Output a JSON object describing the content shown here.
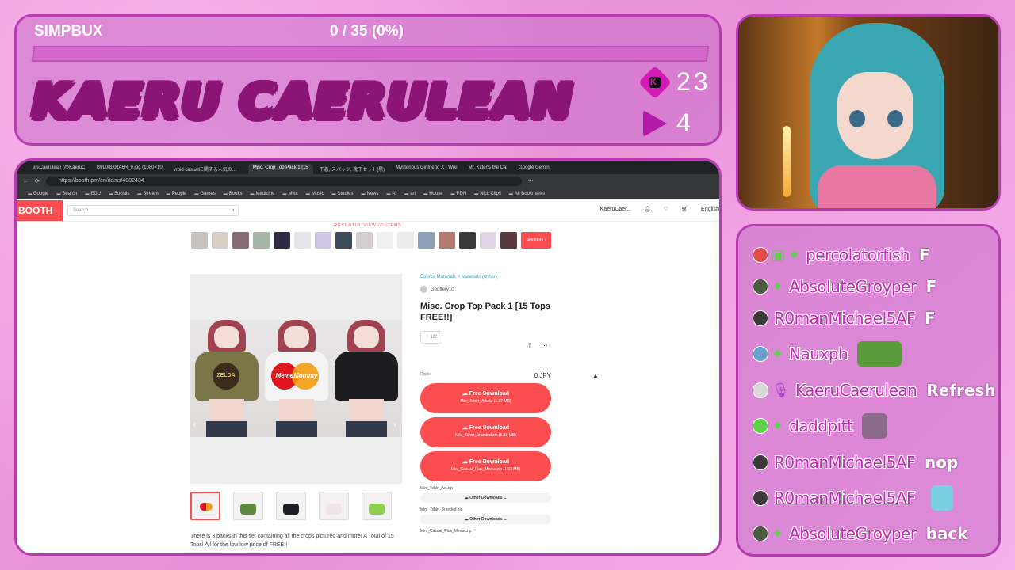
{
  "goal": {
    "label": "SIMPBUX",
    "progress_text": "0 / 35 (0%)",
    "progress": 0
  },
  "streamer": {
    "name": "KAERU CAERULEAN"
  },
  "stats": {
    "kick_count": "23",
    "play_count": "4"
  },
  "browser": {
    "tabs": [
      "eruCaerulean (@KaeruC",
      "G9L0I8XRA6R_9.jpg (1080×10",
      "vroid casualに関する人気の商品",
      "Misc. Crop Top Pack 1 [15",
      "下着, スパッツ, 靴下セット(黒)",
      "Mysterious Girlfriend X - Wiki",
      "Mr. Kittens the Cat",
      "Google Gemini"
    ],
    "active_tab": 3,
    "url": "https://booth.pm/en/items/4002434",
    "bookmarks": [
      "Google",
      "Search",
      "EDU",
      "Socials",
      "Stream",
      "People",
      "Games",
      "Books",
      "Medicine",
      "Misc",
      "Music",
      "Studies",
      "News",
      "AI",
      "art",
      "House",
      "PDN",
      "Nick Clips",
      "All Bookmarks"
    ]
  },
  "site": {
    "logo": "BOOTH",
    "search_placeholder": "Search",
    "user": "KaeruCaer...",
    "language": "English",
    "recently_viewed": "RECENTLY VIEWED ITEMS",
    "see_more": "See More ›",
    "breadcrumb": [
      "Source Materials",
      "Materials (Other)"
    ],
    "seller": "Geoffery10",
    "title": "Misc. Crop Top Pack 1 [15 Tops FREE!!]",
    "likes": "107",
    "type": "Digital",
    "price": "0 JPY",
    "downloads": [
      {
        "label": "Free Download",
        "file": "Mini_Tshirt_Art.zip (1.37 MB)"
      },
      {
        "label": "Free Download",
        "file": "Mini_Tshirt_Branded.zip (5.18 MB)"
      },
      {
        "label": "Free Download",
        "file": "Mini_Casual_Plus_Meme.zip (1.93 MB)"
      }
    ],
    "files": [
      "Mini_Tshirt_Art.zip",
      "Mini_Tshirt_Branded.zip",
      "Mini_Casual_Plus_Meme.zip"
    ],
    "other_downloads": "Other Downloads",
    "shirt_text": [
      "ZELDA",
      "MemeMommy"
    ],
    "description": "There is 3 packs in this set containing all the crops pictured and more! A Total of 15 Tops! All for the low low price of FREE!!"
  },
  "chat": [
    {
      "user": "percolatorfish",
      "text": "F"
    },
    {
      "user": "AbsoluteGroyper",
      "text": "F"
    },
    {
      "user": "R0manMichael5AF",
      "text": "F"
    },
    {
      "user": "Nauxph",
      "text": ""
    },
    {
      "user": "KaeruCaerulean",
      "text": "Refresh"
    },
    {
      "user": "daddpitt",
      "text": ""
    },
    {
      "user": "R0manMichael5AF",
      "text": "nop"
    },
    {
      "user": "R0manMichael5AF",
      "text": ""
    },
    {
      "user": "AbsoluteGroyper",
      "text": "back"
    }
  ],
  "colors": {
    "accent": "#fc4d50",
    "panel_border": "#b93ab0",
    "username": "#c12bb6"
  }
}
